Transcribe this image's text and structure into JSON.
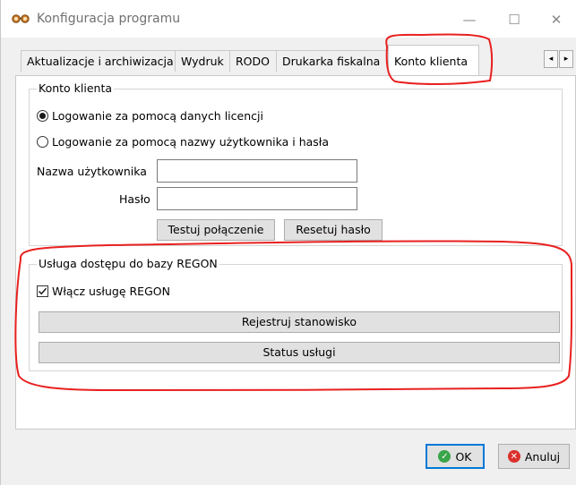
{
  "window": {
    "title": "Konfiguracja programu",
    "app_icon": "glasses-icon",
    "controls": {
      "minimize": "—",
      "maximize": "☐",
      "close": "✕"
    }
  },
  "tabs": [
    {
      "label": "Aktualizacje i archiwizacja",
      "active": false
    },
    {
      "label": "Wydruk",
      "active": false
    },
    {
      "label": "RODO",
      "active": false
    },
    {
      "label": "Drukarka fiskalna",
      "active": false
    },
    {
      "label": "Konto klienta",
      "active": true
    }
  ],
  "tab_scroll": {
    "left": "◂",
    "right": "▸"
  },
  "konto_group": {
    "legend": "Konto klienta",
    "radio_license": {
      "label": "Logowanie za pomocą danych licencji",
      "selected": true
    },
    "radio_user": {
      "label": "Logowanie za pomocą nazwy użytkownika i hasła",
      "selected": false
    },
    "username_label": "Nazwa użytkownika",
    "username_value": "",
    "password_label": "Hasło",
    "password_value": "",
    "test_button": "Testuj połączenie",
    "reset_button": "Resetuj hasło"
  },
  "regon_group": {
    "legend": "Usługa dostępu do bazy REGON",
    "enable_checkbox": {
      "label": "Włącz usługę REGON",
      "checked": true
    },
    "register_button": "Rejestruj stanowisko",
    "status_button": "Status usługi"
  },
  "footer": {
    "ok_label": "OK",
    "cancel_label": "Anuluj"
  },
  "colors": {
    "annotation": "#e8201f",
    "ok_icon": "#3aa54a",
    "cancel_icon": "#d9302c",
    "focus_border": "#0078d7"
  }
}
